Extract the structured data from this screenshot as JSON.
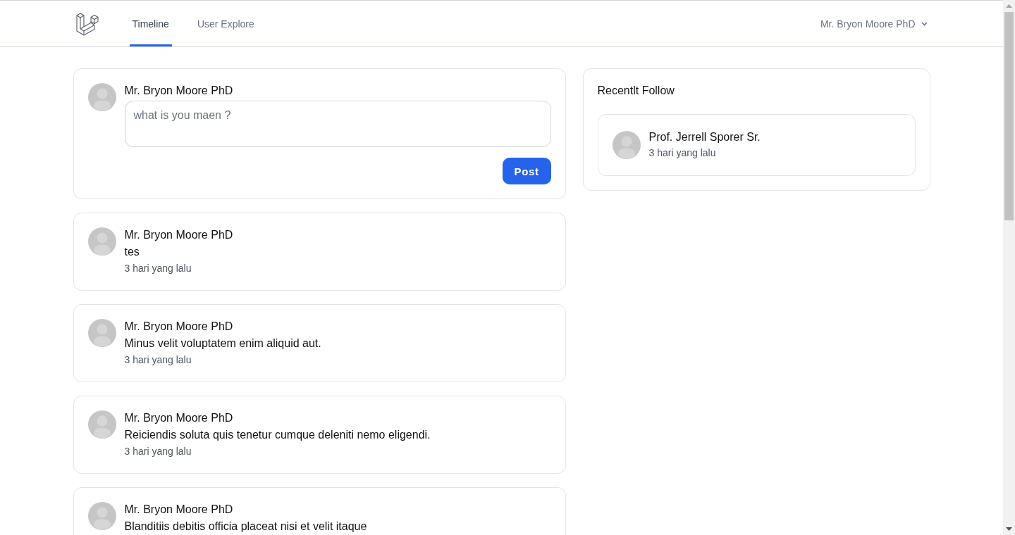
{
  "nav": {
    "tabs": [
      {
        "label": "Timeline",
        "selected": true
      },
      {
        "label": "User Explore",
        "selected": false
      }
    ],
    "user_menu": "Mr. Bryon Moore PhD"
  },
  "composer": {
    "author": "Mr. Bryon Moore PhD",
    "placeholder": "what is you maen ?",
    "button": "Post"
  },
  "posts": [
    {
      "author": "Mr. Bryon Moore PhD",
      "text": "tes",
      "time": "3 hari yang lalu"
    },
    {
      "author": "Mr. Bryon Moore PhD",
      "text": "Minus velit voluptatem enim aliquid aut.",
      "time": "3 hari yang lalu"
    },
    {
      "author": "Mr. Bryon Moore PhD",
      "text": "Reiciendis soluta quis tenetur cumque deleniti nemo eligendi.",
      "time": "3 hari yang lalu"
    },
    {
      "author": "Mr. Bryon Moore PhD",
      "text": "Blanditiis debitis officia placeat nisi et velit itaque"
    }
  ],
  "recent_follow": {
    "title": "Recentlt Follow",
    "users": [
      {
        "name": "Prof. Jerrell Sporer Sr.",
        "time": "3 hari yang lalu"
      }
    ]
  }
}
